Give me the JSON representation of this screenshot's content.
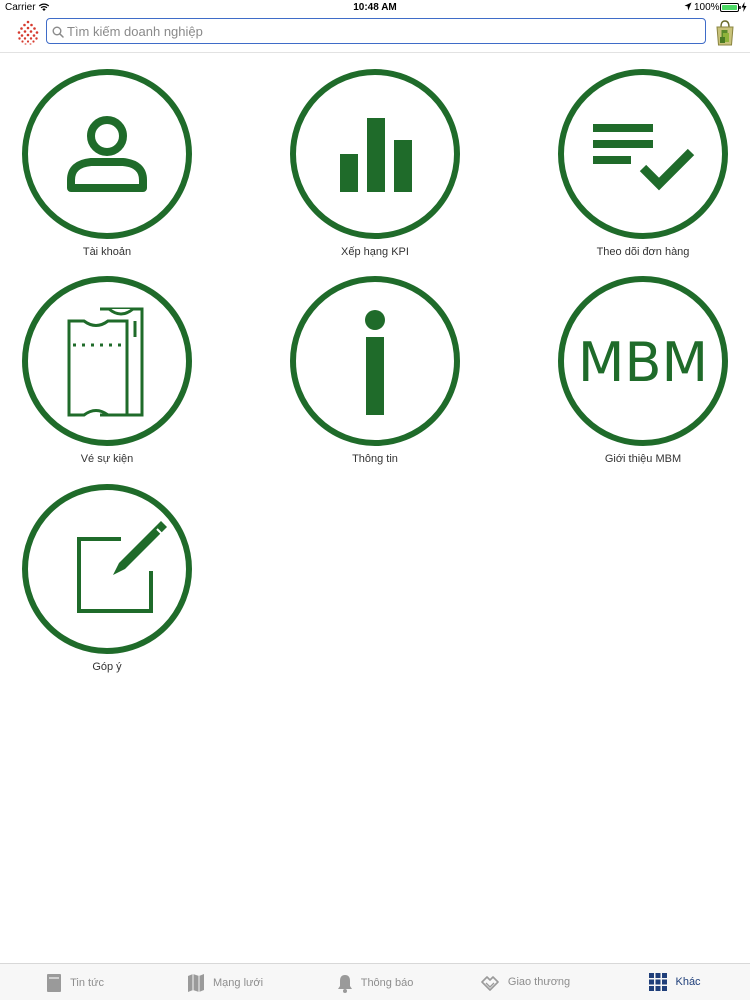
{
  "status_bar": {
    "carrier": "Carrier",
    "time": "10:48 AM",
    "battery": "100%"
  },
  "search": {
    "placeholder": "Tìm kiếm doanh nghiệp",
    "value": ""
  },
  "colors": {
    "accent_green": "#1f6b2a",
    "search_border": "#3f6cc8",
    "tab_active": "#1f3f7a",
    "tab_inactive": "#8e8e8e"
  },
  "tiles": [
    {
      "label": "Tài khoản",
      "icon": "user-icon"
    },
    {
      "label": "Xếp hạng KPI",
      "icon": "bar-chart-icon"
    },
    {
      "label": "Theo dõi đơn hàng",
      "icon": "checklist-icon"
    },
    {
      "label": "Vé sự kiện",
      "icon": "ticket-icon"
    },
    {
      "label": "Thông tin",
      "icon": "info-icon"
    },
    {
      "label": "Giới thiệu MBM",
      "icon": "mbm-logo-icon",
      "logo_text": "MBM"
    },
    {
      "label": "Góp ý",
      "icon": "edit-icon"
    }
  ],
  "tab_bar": {
    "items": [
      {
        "label": "Tin tức",
        "icon": "news-icon"
      },
      {
        "label": "Mạng lưới",
        "icon": "map-icon"
      },
      {
        "label": "Thông báo",
        "icon": "bell-icon"
      },
      {
        "label": "Giao thương",
        "icon": "handshake-icon"
      },
      {
        "label": "Khác",
        "icon": "grid-icon",
        "active": true
      }
    ]
  }
}
